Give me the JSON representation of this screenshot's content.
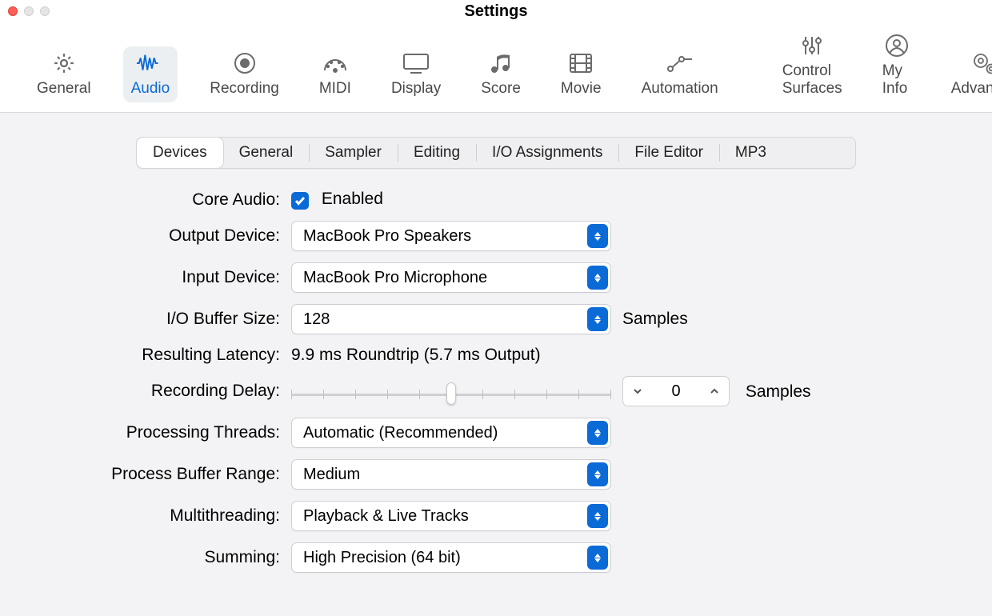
{
  "window": {
    "title": "Settings"
  },
  "toolbar": {
    "items": [
      {
        "label": "General"
      },
      {
        "label": "Audio"
      },
      {
        "label": "Recording"
      },
      {
        "label": "MIDI"
      },
      {
        "label": "Display"
      },
      {
        "label": "Score"
      },
      {
        "label": "Movie"
      },
      {
        "label": "Automation"
      },
      {
        "label": "Control Surfaces"
      },
      {
        "label": "My Info"
      },
      {
        "label": "Advanced"
      }
    ],
    "active": "Audio"
  },
  "subtabs": {
    "items": [
      "Devices",
      "General",
      "Sampler",
      "Editing",
      "I/O Assignments",
      "File Editor",
      "MP3"
    ],
    "active": "Devices"
  },
  "form": {
    "core_audio": {
      "label": "Core Audio:",
      "enabled_text": "Enabled",
      "checked": true
    },
    "output_device": {
      "label": "Output Device:",
      "value": "MacBook Pro Speakers"
    },
    "input_device": {
      "label": "Input Device:",
      "value": "MacBook Pro Microphone"
    },
    "io_buffer": {
      "label": "I/O Buffer Size:",
      "value": "128",
      "suffix": "Samples"
    },
    "latency": {
      "label": "Resulting Latency:",
      "value": "9.9 ms Roundtrip (5.7 ms Output)"
    },
    "recording_delay": {
      "label": "Recording Delay:",
      "value": "0",
      "suffix": "Samples"
    },
    "proc_threads": {
      "label": "Processing Threads:",
      "value": "Automatic (Recommended)"
    },
    "proc_buffer_range": {
      "label": "Process Buffer Range:",
      "value": "Medium"
    },
    "multithreading": {
      "label": "Multithreading:",
      "value": "Playback & Live Tracks"
    },
    "summing": {
      "label": "Summing:",
      "value": "High Precision (64 bit)"
    }
  }
}
